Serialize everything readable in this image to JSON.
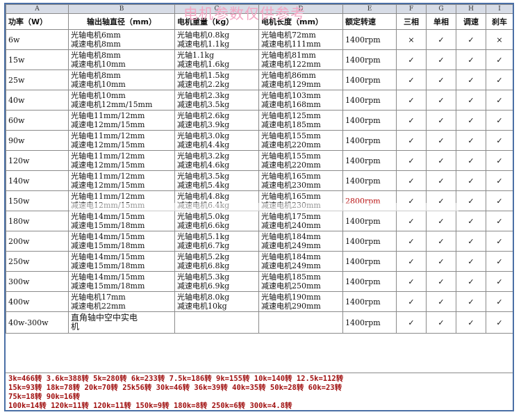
{
  "watermark": "电机参数仅供参考",
  "letters": [
    "A",
    "B",
    "C",
    "D",
    "E",
    "F",
    "G",
    "H",
    "I"
  ],
  "headers": {
    "power": "功率（W）",
    "shaft": "输出轴直径（mm）",
    "weight": "电机重量（kg）",
    "length": "电机长度（mm）",
    "speed": "额定转速",
    "three_phase": "三相",
    "single_phase": "单相",
    "speed_ctrl": "调速",
    "brake": "刹车"
  },
  "rows": [
    {
      "power": "6w",
      "shaft1": "光轴电机6mm",
      "shaft2": "减速电机8mm",
      "weight1": "光轴电机0.8kg",
      "weight2": "减速电机1.1kg",
      "length1": "光轴电机72mm",
      "length2": "减速电机111mm",
      "speed": "1400rpm",
      "three": "×",
      "single": "✓",
      "ctrl": "✓",
      "brake": "×"
    },
    {
      "power": "15w",
      "shaft1": "光轴电机8mm",
      "shaft2": "减速电机10mm",
      "weight1": "光轴1.1kg",
      "weight2": "减速电机1.6kg",
      "length1": "光轴电机81mm",
      "length2": "减速电机122mm",
      "speed": "1400rpm",
      "three": "✓",
      "single": "✓",
      "ctrl": "✓",
      "brake": "✓"
    },
    {
      "power": "25w",
      "shaft1": "光轴电机8mm",
      "shaft2": "减速电机10mm",
      "weight1": "光轴电机1.5kg",
      "weight2": "减速电机2.2kg",
      "length1": "光轴电机86mm",
      "length2": "减速电机129mm",
      "speed": "1400rpm",
      "three": "✓",
      "single": "✓",
      "ctrl": "✓",
      "brake": "✓"
    },
    {
      "power": "40w",
      "shaft1": "光轴电机10mm",
      "shaft2": "减速电机12mm/15mm",
      "weight1": "光轴电机2.3kg",
      "weight2": "减速电机3.5kg",
      "length1": "光轴电机103mm",
      "length2": "减速电机168mm",
      "speed": "1400rpm",
      "three": "✓",
      "single": "✓",
      "ctrl": "✓",
      "brake": "✓"
    },
    {
      "power": "60w",
      "shaft1": "光轴电11mm/12mm",
      "shaft2": "减速电12mm/15mm",
      "weight1": "光轴电机2.6kg",
      "weight2": "减速电机3.9kg",
      "length1": "光轴电机125mm",
      "length2": "减速电机185mm",
      "speed": "1400rpm",
      "three": "✓",
      "single": "✓",
      "ctrl": "✓",
      "brake": "✓"
    },
    {
      "power": "90w",
      "shaft1": "光轴电11mm/12mm",
      "shaft2": "减速电12mm/15mm",
      "weight1": "光轴电机3.0kg",
      "weight2": "减速电机4.4kg",
      "length1": "光轴电机155mm",
      "length2": "减速电机220mm",
      "speed": "1400rpm",
      "three": "✓",
      "single": "✓",
      "ctrl": "✓",
      "brake": "✓"
    },
    {
      "power": "120w",
      "shaft1": "光轴电11mm/12mm",
      "shaft2": "减速电12mm/15mm",
      "weight1": "光轴电机3.2kg",
      "weight2": "减速电机4.6kg",
      "length1": "光轴电机155mm",
      "length2": "减速电机220mm",
      "speed": "1400rpm",
      "three": "✓",
      "single": "✓",
      "ctrl": "✓",
      "brake": "✓"
    },
    {
      "power": "140w",
      "shaft1": "光轴电11mm/12mm",
      "shaft2": "减速电12mm/15mm",
      "weight1": "光轴电机3.5kg",
      "weight2": "减速电机5.4kg",
      "length1": "光轴电机165mm",
      "length2": "减速电机230mm",
      "speed": "1400rpm",
      "three": "✓",
      "single": "✓",
      "ctrl": "✓",
      "brake": "✓"
    },
    {
      "power": "150w",
      "shaft1": "光轴电11mm/12mm",
      "shaft2": "减速电12mm/15mm",
      "weight1": "光轴电机4.8kg",
      "weight2": "减速电机6.4kg",
      "length1": "光轴电机165mm",
      "length2": "减速电机230mm",
      "speed": "2800rpm",
      "speed_red": true,
      "three": "✓",
      "single": "✓",
      "ctrl": "✓",
      "brake": "✓"
    },
    {
      "power": "180w",
      "shaft1": "光轴电14mm/15mm",
      "shaft2": "减速电15mm/18mm",
      "weight1": "光轴电机5.0kg",
      "weight2": "减速电机6.6kg",
      "length1": "光轴电机175mm",
      "length2": "减速电机240mm",
      "speed": "1400rpm",
      "three": "✓",
      "single": "✓",
      "ctrl": "✓",
      "brake": "✓"
    },
    {
      "power": "200w",
      "shaft1": "光轴电14mm/15mm",
      "shaft2": "减速电15mm/18mm",
      "weight1": "光轴电机5.1kg",
      "weight2": "减速电机6.7kg",
      "length1": "光轴电机184mm",
      "length2": "减速电机249mm",
      "speed": "1400rpm",
      "three": "✓",
      "single": "✓",
      "ctrl": "✓",
      "brake": "✓"
    },
    {
      "power": "250w",
      "shaft1": "光轴电14mm/15mm",
      "shaft2": "减速电15mm/18mm",
      "weight1": "光轴电机5.2kg",
      "weight2": "减速电机6.8kg",
      "length1": "光轴电机184mm",
      "length2": "减速电机249mm",
      "speed": "1400rpm",
      "three": "✓",
      "single": "✓",
      "ctrl": "✓",
      "brake": "✓"
    },
    {
      "power": "300w",
      "shaft1": "光轴电14mm/15mm",
      "shaft2": "减速电15mm/18mm",
      "weight1": "光轴电机5.3kg",
      "weight2": "减速电机6.9kg",
      "length1": "光轴电机185mm",
      "length2": "减速电机250mm",
      "speed": "1400rpm",
      "three": "✓",
      "single": "✓",
      "ctrl": "✓",
      "brake": "✓"
    },
    {
      "power": "400w",
      "shaft1": "光轴电机17mm",
      "shaft2": "减速电机22mm",
      "weight1": "光轴电机8.0kg",
      "weight2": "减速电机10kg",
      "length1": "光轴电机190mm",
      "length2": "减速电机290mm",
      "speed": "1400rpm",
      "three": "✓",
      "single": "✓",
      "ctrl": "✓",
      "brake": "✓"
    }
  ],
  "last_row": {
    "power": "40w-300w",
    "shaft1": "直角轴中空中实电",
    "shaft2": "机",
    "speed": "1400rpm",
    "three": "✓",
    "single": "✓",
    "ctrl": "✓",
    "brake": "✓"
  },
  "conversion_lines": [
    "3k=466转 3.6k=388转 5k=280转 6k=233转 7.5k=186转 9k=155转 10k=140转 12.5k=112转",
    "15k=93转 18k=78转 20k=70转 25k56转 30k=46转 36k=39转 40k=35转 50k=28转 60k=23转",
    "75k=18转 90k=16转",
    "100k=14转 120k=11转 120k=11转 150k=9转 180k=8转 250k=6转 300k=4.8转"
  ]
}
